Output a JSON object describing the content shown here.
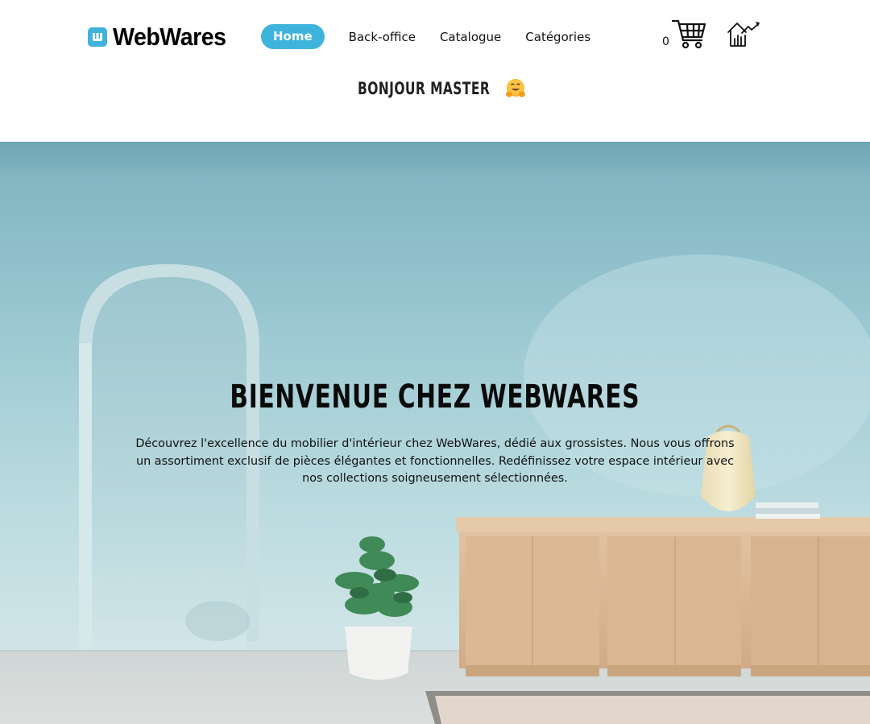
{
  "brand": {
    "name": "WebWares",
    "logo_icon": "w-logo-icon",
    "accent": "#3eb3dc"
  },
  "nav": {
    "items": [
      {
        "label": "Home",
        "active": true
      },
      {
        "label": "Back-office",
        "active": false
      },
      {
        "label": "Catalogue",
        "active": false
      },
      {
        "label": "Catégories",
        "active": false
      }
    ]
  },
  "cart": {
    "count": "0",
    "icon": "shopping-cart-icon"
  },
  "dashboard_icon": "house-chart-icon",
  "greeting": {
    "text": "BONJOUR MASTER",
    "emoji": "hugging-face-emoji"
  },
  "hero": {
    "title": "BIENVENUE CHEZ WEBWARES",
    "description": "Découvrez l'excellence du mobilier d'intérieur chez WebWares, dédié aux grossistes. Nous vous offrons un assortiment exclusif de pièces élégantes et fonctionnelles. Redéfinissez votre espace intérieur avec nos collections soigneusement sélectionnées.",
    "background": "interior-room-arch-plant-sideboard-image"
  },
  "colors": {
    "accent": "#3eb3dc",
    "hero_wall": "#9fcad3",
    "wood": "#d8b48f"
  }
}
